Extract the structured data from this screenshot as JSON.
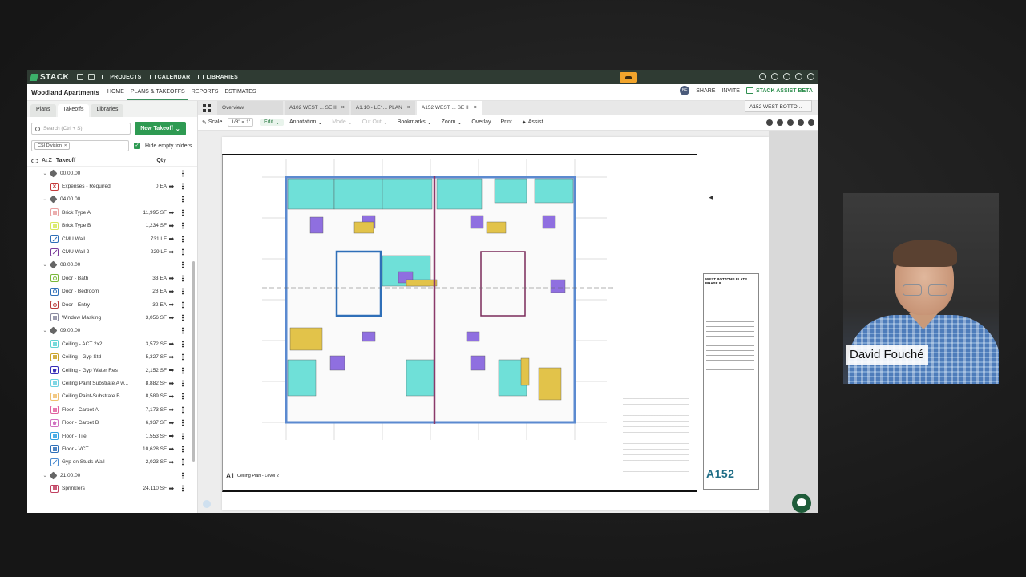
{
  "topbar": {
    "logo": "STACK",
    "nav": [
      "PROJECTS",
      "CALENDAR",
      "LIBRARIES"
    ]
  },
  "navbar": {
    "project": "Woodland Apartments",
    "items": [
      "HOME",
      "PLANS & TAKEOFFS",
      "REPORTS",
      "ESTIMATES"
    ],
    "avatar": "BE",
    "share": "SHARE",
    "invite": "INVITE",
    "assist": "STACK ASSIST BETA"
  },
  "sidebar": {
    "tabs": [
      "Plans",
      "Takeoffs",
      "Libraries"
    ],
    "search_placeholder": "Search (Ctrl + S)",
    "new_takeoff": "New Takeoff",
    "filter_chip": "CSI Division",
    "hide_empty": "Hide empty folders",
    "col_takeoff": "Takeoff",
    "col_qty": "Qty",
    "rows": [
      {
        "type": "group",
        "label": "00.00.00"
      },
      {
        "type": "item",
        "label": "Expenses - Required",
        "qty": "0 EA",
        "color": "#c43a3a",
        "shape": "x"
      },
      {
        "type": "group",
        "label": "04.00.00"
      },
      {
        "type": "item",
        "label": "Brick Type A",
        "qty": "11,995 SF",
        "color": "#e8a0a0",
        "shape": "fill"
      },
      {
        "type": "item",
        "label": "Brick Type B",
        "qty": "1,234 SF",
        "color": "#d6e85a",
        "shape": "fill"
      },
      {
        "type": "item",
        "label": "CMU Wall",
        "qty": "731 LF",
        "color": "#2f6fb8",
        "shape": "line"
      },
      {
        "type": "item",
        "label": "CMU Wall 2",
        "qty": "229 LF",
        "color": "#7a3a9a",
        "shape": "line"
      },
      {
        "type": "group",
        "label": "08.00.00"
      },
      {
        "type": "item",
        "label": "Door - Bath",
        "qty": "33 EA",
        "color": "#7ab83a",
        "shape": "circle"
      },
      {
        "type": "item",
        "label": "Door - Bedroom",
        "qty": "28 EA",
        "color": "#2f6fb8",
        "shape": "circle"
      },
      {
        "type": "item",
        "label": "Door - Entry",
        "qty": "32 EA",
        "color": "#b83a3a",
        "shape": "circle"
      },
      {
        "type": "item",
        "label": "Window Masking",
        "qty": "3,056 SF",
        "color": "#8a8aa0",
        "shape": "fill"
      },
      {
        "type": "group",
        "label": "09.00.00"
      },
      {
        "type": "item",
        "label": "Ceiling - ACT 2x2",
        "qty": "3,572 SF",
        "color": "#5fd3d3",
        "shape": "fill"
      },
      {
        "type": "item",
        "label": "Ceiling - Gyp Std",
        "qty": "5,327 SF",
        "color": "#c9a227",
        "shape": "fill"
      },
      {
        "type": "item",
        "label": "Ceiling - Gyp Water Res",
        "qty": "2,152 SF",
        "color": "#3a2fb8",
        "shape": "pent"
      },
      {
        "type": "item",
        "label": "Ceiling Paint Substrate A w...",
        "qty": "8,882 SF",
        "color": "#6ad0e0",
        "shape": "fill"
      },
      {
        "type": "item",
        "label": "Ceiling Paint-Substrate B",
        "qty": "8,589 SF",
        "color": "#f0c070",
        "shape": "fill"
      },
      {
        "type": "item",
        "label": "Floor - Carpet A",
        "qty": "7,173 SF",
        "color": "#e060a0",
        "shape": "fill"
      },
      {
        "type": "item",
        "label": "Floor - Carpet B",
        "qty": "6,937 SF",
        "color": "#d070c0",
        "shape": "pent"
      },
      {
        "type": "item",
        "label": "Floor - Tile",
        "qty": "1,553 SF",
        "color": "#2fa0e0",
        "shape": "fill"
      },
      {
        "type": "item",
        "label": "Floor - VCT",
        "qty": "10,628 SF",
        "color": "#2f6fb8",
        "shape": "fill"
      },
      {
        "type": "item",
        "label": "Gyp on Studs Wall",
        "qty": "2,023 SF",
        "color": "#4a8ad0",
        "shape": "line"
      },
      {
        "type": "group",
        "label": "21.00.00"
      },
      {
        "type": "item",
        "label": "Sprinklers",
        "qty": "24,110 SF",
        "color": "#c04060",
        "shape": "fill"
      }
    ]
  },
  "doc_tabs": [
    {
      "label": "Overview"
    },
    {
      "label": "A102 WEST ... SE II"
    },
    {
      "label": "A1.10 - LE^... PLAN"
    },
    {
      "label": "A152 WEST ... SE II",
      "active": true
    }
  ],
  "toolbar": {
    "scale": "Scale",
    "scale_value": "1/8\" = 1'",
    "edit": "Edit",
    "annotation": "Annotation",
    "mode": "Mode",
    "cut_out": "Cut Out",
    "bookmarks": "Bookmarks",
    "zoom": "Zoom",
    "overlay": "Overlay",
    "print": "Print",
    "assist": "Assist",
    "sheet_select": "A152 WEST BOTTO..."
  },
  "drawing": {
    "plan_number": "A1",
    "plan_title": "Ceiling Plan - Level 2",
    "project_title": "WEST BOTTOMS FLATS PHASE II",
    "sheet_number": "A152"
  },
  "webcam": {
    "name": "David Fouché"
  }
}
